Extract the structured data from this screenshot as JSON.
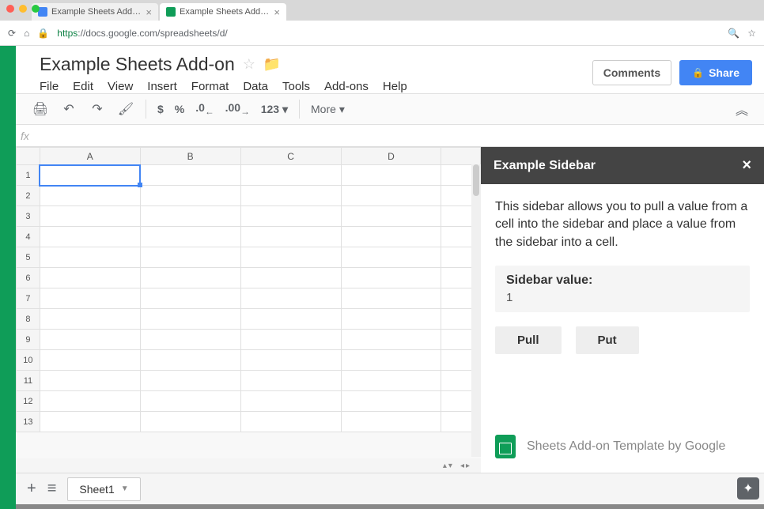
{
  "browser": {
    "tabs": [
      {
        "title": "Example Sheets Add-on",
        "icon": "blue"
      },
      {
        "title": "Example Sheets Add-on - Go...",
        "icon": "green"
      }
    ],
    "url_prefix": "https",
    "url_rest": "://docs.google.com/spreadsheets/d/"
  },
  "doc": {
    "title": "Example Sheets Add-on",
    "comments_label": "Comments",
    "share_label": "Share"
  },
  "menu": {
    "items": [
      "File",
      "Edit",
      "View",
      "Insert",
      "Format",
      "Data",
      "Tools",
      "Add-ons",
      "Help"
    ]
  },
  "toolbar": {
    "currency": "$",
    "percent": "%",
    "dec_dec": ".0",
    "inc_dec": ".00",
    "num_format": "123",
    "more": "More"
  },
  "formula": {
    "fx": "fx"
  },
  "grid": {
    "columns": [
      "A",
      "B",
      "C",
      "D",
      ""
    ],
    "rows": [
      "1",
      "2",
      "3",
      "4",
      "5",
      "6",
      "7",
      "8",
      "9",
      "10",
      "11",
      "12",
      "13"
    ],
    "selected": "A1"
  },
  "sidebar": {
    "title": "Example Sidebar",
    "description": "This sidebar allows you to pull a value from a cell into the sidebar and place a value from the sidebar into a cell.",
    "value_label": "Sidebar value:",
    "value": "1",
    "pull_label": "Pull",
    "put_label": "Put",
    "footer": "Sheets Add-on Template by Google"
  },
  "sheets": {
    "tab1": "Sheet1"
  }
}
